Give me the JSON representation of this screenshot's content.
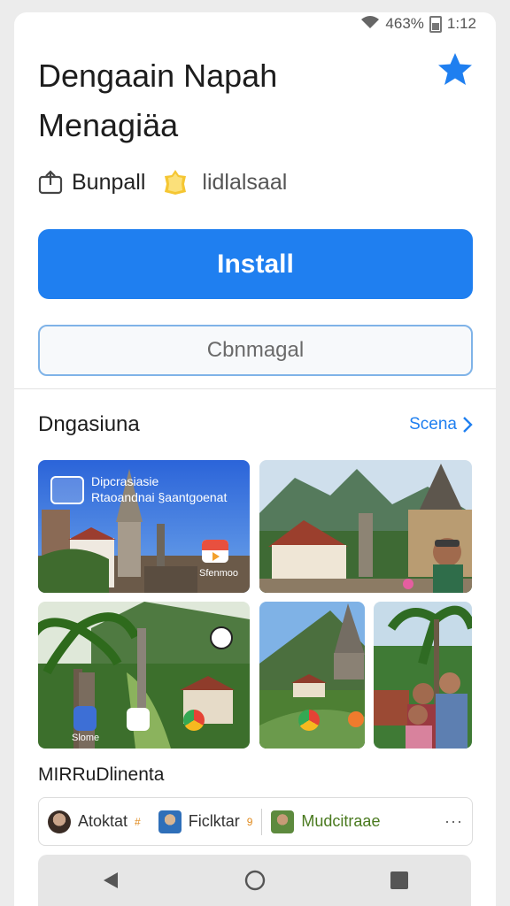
{
  "status_bar": {
    "battery": "463%",
    "time": "1:12"
  },
  "app": {
    "title_line1": "Dengaain Napah",
    "title_line2": "Menagiäa",
    "developer": "Bunpall",
    "category": "lidlalsaal"
  },
  "actions": {
    "install_label": "Install",
    "secondary_label": "Cbnmagal"
  },
  "screenshots_section": {
    "title": "Dngasiuna",
    "see_all": "Scena",
    "shot1": {
      "line1": "Dipcrasiasie",
      "line2": "Rtaoandnai §aantgoenat",
      "caption": "Sfenmoo"
    },
    "shot4_label": "Slome"
  },
  "people_section": {
    "title": "MIRRuDlinenta",
    "people": [
      {
        "name": "Atoktat",
        "mark": "#"
      },
      {
        "name": "Ficlktar",
        "mark": "9"
      },
      {
        "name": "Mudcitraae",
        "mark": ""
      }
    ],
    "more": "···"
  },
  "colors": {
    "accent": "#1f7ff0",
    "outline": "#7fb3e8"
  },
  "icons": [
    "wifi-icon",
    "battery-icon",
    "star-icon",
    "share-icon",
    "badge-icon",
    "chevron-right-icon",
    "back-icon",
    "home-icon",
    "recents-icon"
  ]
}
